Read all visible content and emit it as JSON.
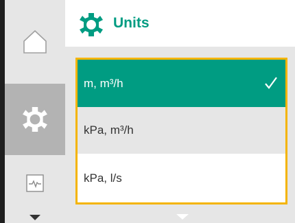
{
  "header": {
    "title": "Units",
    "icon": "gear-icon"
  },
  "sidebar": {
    "items": [
      {
        "name": "home",
        "icon": "home-icon",
        "active": false
      },
      {
        "name": "settings",
        "icon": "gear-icon",
        "active": true
      },
      {
        "name": "diagnostics",
        "icon": "pulse-monitor-icon",
        "active": false
      }
    ],
    "scroll_icon": "triangle-down-icon"
  },
  "options": [
    {
      "label": "m, m³/h",
      "selected": true
    },
    {
      "label": "kPa, m³/h",
      "selected": false
    },
    {
      "label": "kPa, l/s",
      "selected": false
    }
  ],
  "colors": {
    "accent": "#009c82",
    "focus_border": "#f4b400",
    "sidebar_bg": "#e6e6e6",
    "sidebar_active": "#b3b3b3",
    "bezel": "#1f1f1f"
  },
  "more_indicator_icon": "triangle-down-icon"
}
